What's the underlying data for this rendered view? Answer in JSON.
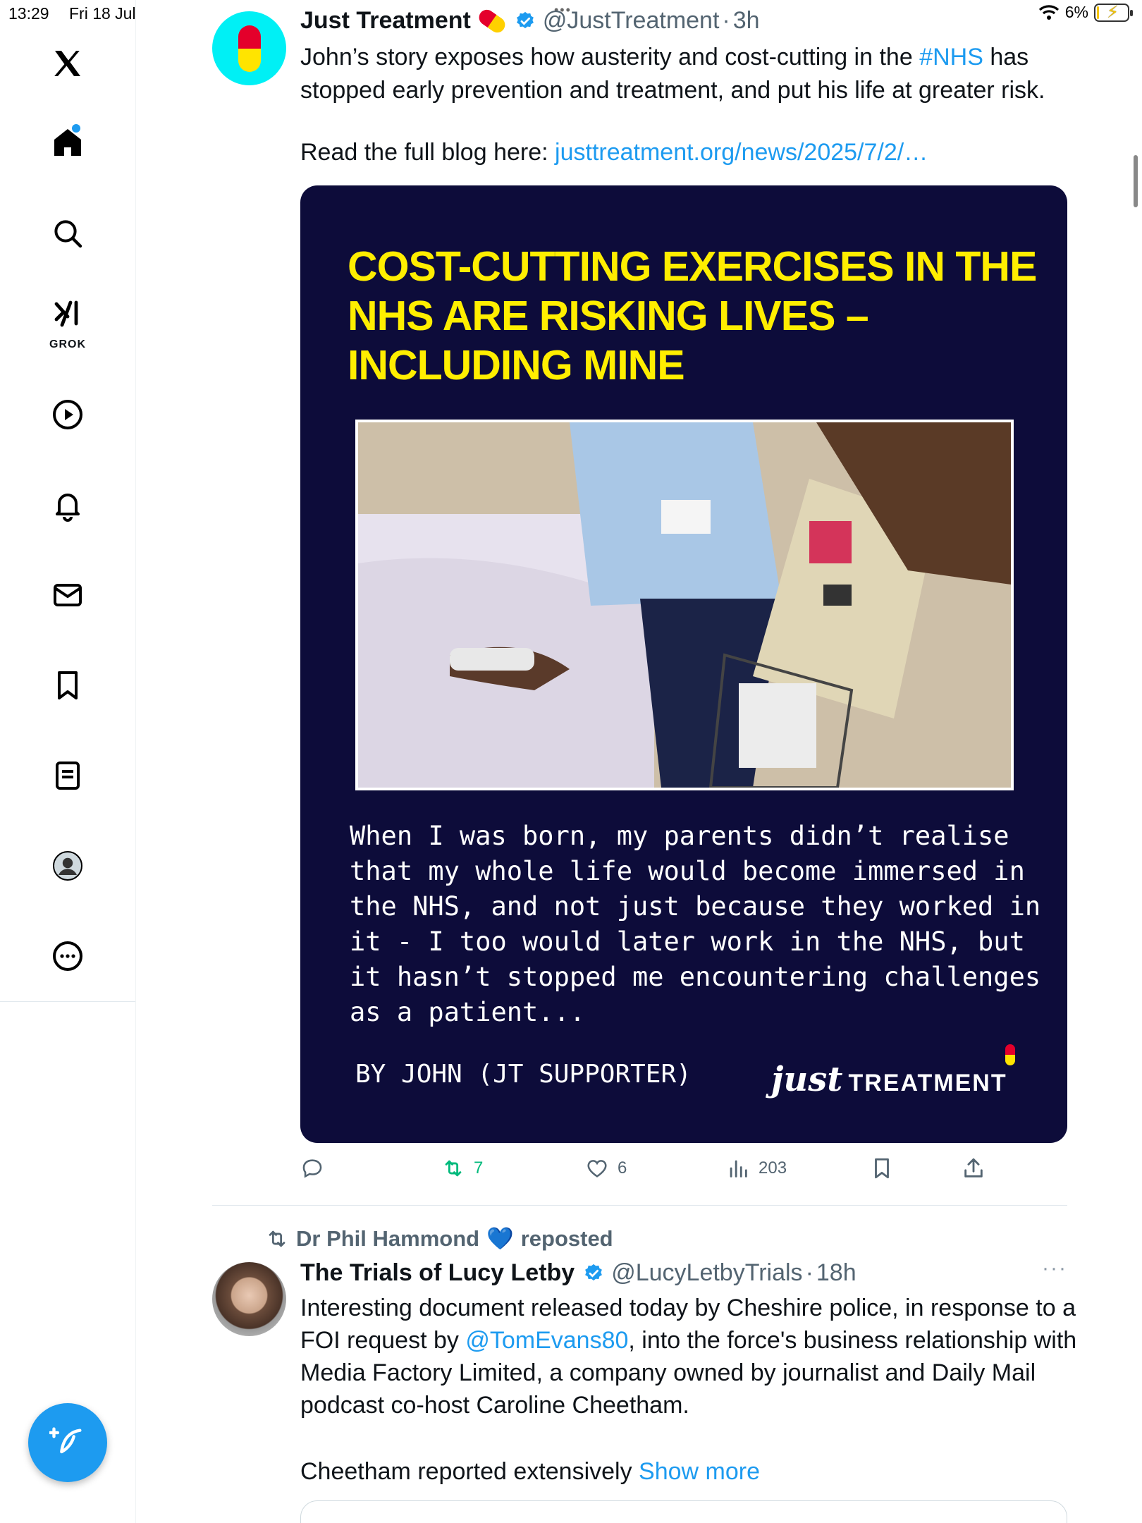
{
  "status_bar": {
    "time": "13:29",
    "date": "Fri 18 Jul",
    "battery": "6%",
    "battery_level_percent": 6,
    "battery_charging": true,
    "wifi": "wifi-icon"
  },
  "sidebar": {
    "items": [
      {
        "name": "home",
        "icon": "home-icon",
        "active": true
      },
      {
        "name": "search",
        "icon": "search-icon"
      },
      {
        "name": "grok",
        "icon": "grok-icon",
        "label": "GROK"
      },
      {
        "name": "video",
        "icon": "play-icon"
      },
      {
        "name": "notifications",
        "icon": "bell-icon"
      },
      {
        "name": "messages",
        "icon": "mail-icon"
      },
      {
        "name": "bookmarks",
        "icon": "bookmark-icon"
      },
      {
        "name": "lists",
        "icon": "list-icon"
      },
      {
        "name": "profile",
        "icon": "profile-icon"
      },
      {
        "name": "more",
        "icon": "more-icon"
      }
    ],
    "compose_icon": "compose-icon"
  },
  "tweet1": {
    "name": "Just Treatment",
    "handle": "@JustTreatment",
    "time": "3h",
    "text_before": "John’s story exposes how austerity and cost-cutting in the ",
    "hashtag": "#NHS",
    "text_after": " has stopped early prevention and treatment, and put his life at greater risk.",
    "readmore_label": "Read the full blog here: ",
    "readmore_link": "justtreatment.org/news/2025/7/2/…",
    "media": {
      "title": "COST-CUTTING EXERCISES IN THE NHS ARE RISKING LIVES – INCLUDING MINE",
      "quote": "When I was born, my parents didn’t realise that my whole life would become immersed in the NHS, and not just because they worked in it - I too would later work in the NHS, but it hasn’t stopped me encountering challenges as a patient...",
      "byline": "BY JOHN (JT SUPPORTER)",
      "logo_script": "just",
      "logo_word": "TREATMENT"
    },
    "actions": {
      "reply": "",
      "retweets": "7",
      "likes": "6",
      "views": "203"
    },
    "colors": {
      "title_yellow": "#ffee00",
      "card_navy": "#0d0c3a",
      "avatar_cyan": "#00f0f5"
    }
  },
  "tweet2": {
    "reposted_by": "Dr Phil Hammond",
    "reposted_label": "reposted",
    "name": "The Trials of Lucy Letby",
    "handle": "@LucyLetbyTrials",
    "time": "18h",
    "more": "···",
    "text_1": "Interesting document released today by Cheshire police, in response to a FOI request by ",
    "mention": "@TomEvans80",
    "text_2": ", into the force's business relationship with Media Factory Limited, a company owned by journalist and Daily Mail podcast co-host Caroline Cheetham.",
    "continuation": "Cheetham reported extensively ",
    "show_more": "Show more"
  },
  "colors": {
    "accent": "#1d9bf0",
    "retweet_green": "#00ba7c",
    "muted": "#536471"
  }
}
